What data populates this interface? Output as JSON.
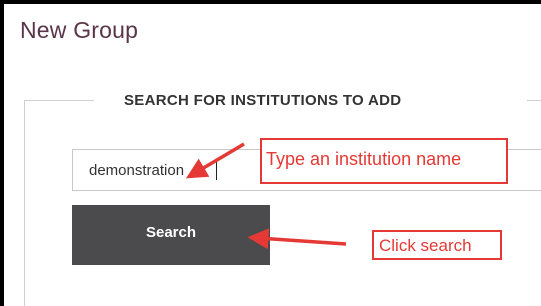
{
  "page": {
    "title": "New Group"
  },
  "search_section": {
    "legend": "SEARCH FOR INSTITUTIONS TO ADD",
    "input_value": "demonstration",
    "search_button_label": "Search"
  },
  "annotations": {
    "type_hint": "Type an institution name",
    "click_hint": "Click search",
    "callout_color": "#e53935"
  },
  "colors": {
    "title": "#5a3448",
    "button_bg": "#4b4b4d"
  }
}
